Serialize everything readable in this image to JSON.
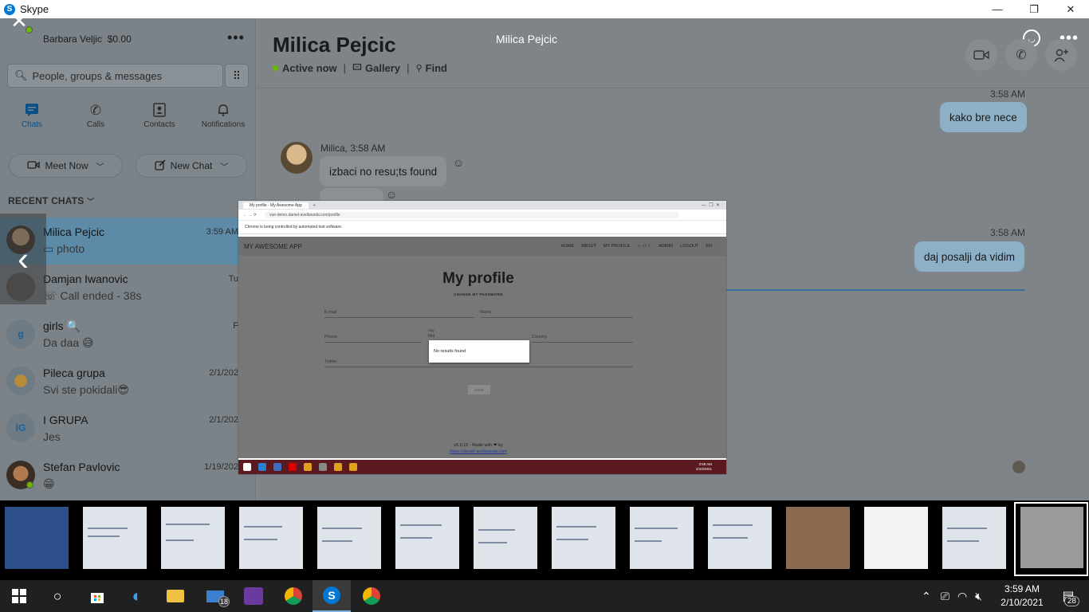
{
  "window": {
    "title": "Skype",
    "controls": [
      "—",
      "❐",
      "✕"
    ]
  },
  "profile": {
    "name": "Barbara Veljic",
    "balance": "$0.00"
  },
  "search": {
    "placeholder": "People, groups & messages"
  },
  "nav": [
    {
      "label": "Chats",
      "icon": "chat-icon"
    },
    {
      "label": "Calls",
      "icon": "phone-icon"
    },
    {
      "label": "Contacts",
      "icon": "contacts-icon"
    },
    {
      "label": "Notifications",
      "icon": "bell-icon"
    }
  ],
  "actions": {
    "meet_now": "Meet Now",
    "new_chat": "New Chat"
  },
  "recent_header": "RECENT CHATS",
  "chats": [
    {
      "name": "Milica Pejcic",
      "msg": "photo",
      "time": "3:59 AM",
      "initials": ""
    },
    {
      "name": "Damjan Iwanovic",
      "msg": "Call ended - 38s",
      "time": "Tu",
      "initials": ""
    },
    {
      "name": "girls 🔍",
      "msg": "Da daa 😅",
      "time": "F",
      "initials": "g"
    },
    {
      "name": "Pileca grupa",
      "msg": "Svi ste pokidali😎",
      "time": "2/1/202",
      "initials": ""
    },
    {
      "name": "I GRUPA",
      "msg": "Jes",
      "time": "2/1/202",
      "initials": "IG"
    },
    {
      "name": "Stefan Pavlovic",
      "msg": "😁",
      "time": "1/19/202",
      "initials": ""
    }
  ],
  "conversation": {
    "title": "Milica Pejcic",
    "status": "Active now",
    "gallery": "Gallery",
    "find": "Find",
    "viewer_title": "Milica Pejcic",
    "messages": [
      {
        "time": "3:58 AM",
        "text": "kako bre nece"
      },
      {
        "meta": "Milica, 3:58 AM",
        "text": "izbaci no resu;ts found"
      },
      {
        "time": "3:58 AM",
        "text": "daj posalji da vidim"
      }
    ]
  },
  "screenshot": {
    "tab": "My profile - My Awesome App",
    "url": "vue-demo.daniel-avellaneda.com/profile",
    "infobar": "Chrome is being controlled by automated test software.",
    "app_name": "MY AWESOME APP",
    "nav": [
      "HOME",
      "ABOUT",
      "MY PROFILE",
      "ADMIN",
      "LOGOUT",
      "EN"
    ],
    "page_title": "My profile",
    "subtitle": "CHANGE MY PASSWORD",
    "fields": {
      "email": "E-mail",
      "name": "Name",
      "phone": "Phone",
      "city_label": "City",
      "city_value": "Nei",
      "country": "Country",
      "twitter": "Twitter"
    },
    "popup": "No results found",
    "save": "SAVE",
    "footer_line1": "v5.0.15 - Made with ❤ by",
    "footer_link": "https://daniel-avellaneda.com",
    "clock": "3:58 AM",
    "date": "2/10/2021"
  },
  "taskbar": {
    "mail_badge": "18",
    "time": "3:59 AM",
    "date": "2/10/2021",
    "notifications": "28"
  }
}
